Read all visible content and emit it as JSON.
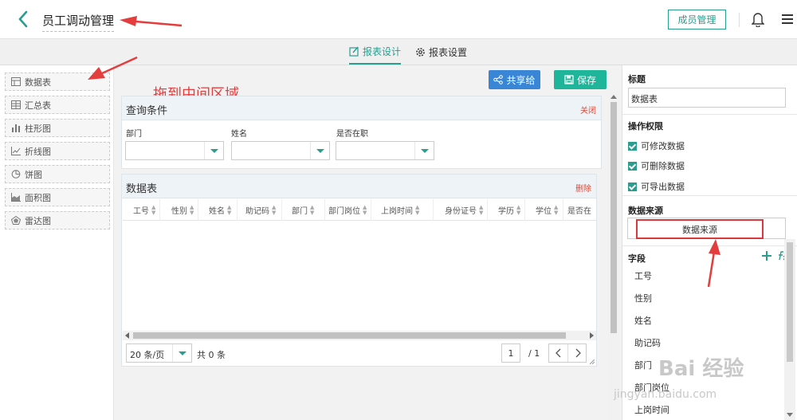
{
  "header": {
    "title": "员工调动管理",
    "member_button": "成员管理"
  },
  "tabs": [
    {
      "label": "报表设计",
      "active": true
    },
    {
      "label": "报表设置",
      "active": false
    }
  ],
  "widgets": [
    {
      "label": "数据表",
      "icon": "table-icon"
    },
    {
      "label": "汇总表",
      "icon": "summary-table-icon"
    },
    {
      "label": "柱形图",
      "icon": "bar-chart-icon"
    },
    {
      "label": "折线图",
      "icon": "line-chart-icon"
    },
    {
      "label": "饼图",
      "icon": "pie-chart-icon"
    },
    {
      "label": "面积图",
      "icon": "area-chart-icon"
    },
    {
      "label": "雷达图",
      "icon": "radar-chart-icon"
    }
  ],
  "annotation": "拖到中间区域",
  "toolbar": {
    "share_label": "共享给",
    "save_label": "保存"
  },
  "query_panel": {
    "title": "查询条件",
    "close_label": "关闭",
    "filters": [
      {
        "label": "部门",
        "value": ""
      },
      {
        "label": "姓名",
        "value": ""
      },
      {
        "label": "是否在职",
        "value": ""
      }
    ]
  },
  "data_panel": {
    "title": "数据表",
    "delete_label": "删除",
    "columns": [
      "工号",
      "性别",
      "姓名",
      "助记码",
      "部门",
      "部门岗位",
      "上岗时间",
      "身份证号",
      "学历",
      "学位",
      "是否在"
    ],
    "page_size": "20 条/页",
    "total": "共 0 条",
    "page_current": "1",
    "page_total": "/ 1"
  },
  "right_panel": {
    "title_heading": "标题",
    "title_value": "数据表",
    "permissions_heading": "操作权限",
    "permissions": [
      "可修改数据",
      "可删除数据",
      "可导出数据"
    ],
    "datasource_heading": "数据来源",
    "datasource_button": "数据来源",
    "fields_heading": "字段",
    "fields": [
      "工号",
      "性别",
      "姓名",
      "助记码",
      "部门",
      "部门岗位",
      "上岗时间"
    ]
  },
  "watermark": {
    "text": "Bai 经验",
    "sub": "jingyan.baidu.com"
  },
  "colors": {
    "accent": "#2a9d8f",
    "share": "#3a86d6",
    "save": "#1fb59a",
    "annotation": "#e43d3d"
  }
}
